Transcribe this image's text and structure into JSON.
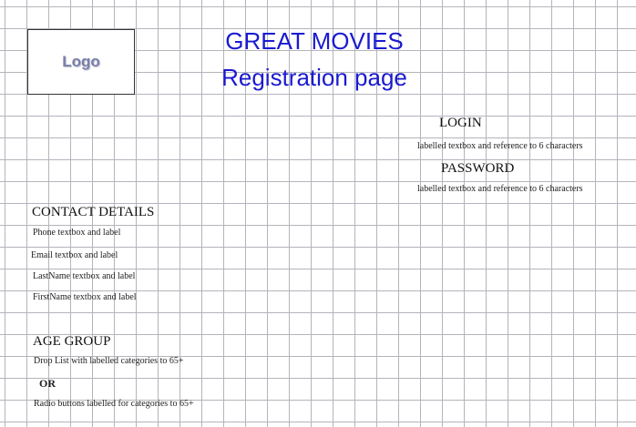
{
  "logo": {
    "text": "Logo"
  },
  "header": {
    "title": "GREAT MOVIES",
    "subtitle": "Registration page"
  },
  "login_section": {
    "login_label": "LOGIN",
    "login_note": "labelled textbox and reference to 6 characters",
    "password_label": "PASSWORD",
    "password_note": "labelled textbox and reference to 6 characters"
  },
  "contact_section": {
    "heading": "CONTACT DETAILS",
    "items": [
      "Phone textbox and label",
      "Email textbox and label",
      "LastName textbox and label",
      "FirstName textbox and label"
    ]
  },
  "age_section": {
    "heading": "AGE GROUP",
    "drop_list_note": "Drop List with labelled categories to 65+",
    "or_label": "OR",
    "radio_note": "Radio buttons labelled for categories to 65+"
  },
  "colors": {
    "title_blue": "#1a1ad0",
    "grid_line": "#b4b4bc",
    "logo_text": "#7a7fa8"
  }
}
